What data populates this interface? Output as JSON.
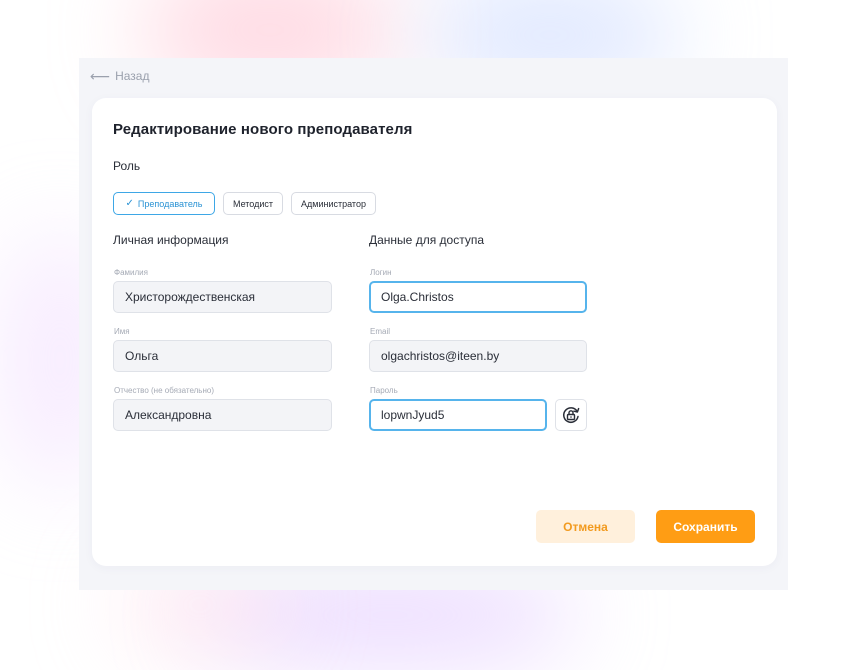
{
  "back_label": "Назад",
  "title": "Редактирование нового преподавателя",
  "role": {
    "label": "Роль",
    "options": [
      "Преподаватель",
      "Методист",
      "Администратор"
    ],
    "selected": "Преподаватель"
  },
  "personal": {
    "heading": "Личная информация",
    "last_name": {
      "label": "Фамилия",
      "value": "Христорождественская"
    },
    "first_name": {
      "label": "Имя",
      "value": "Ольга"
    },
    "patronymic": {
      "label": "Отчество (не обязательно)",
      "value": "Александровна"
    }
  },
  "access": {
    "heading": "Данные для доступа",
    "login": {
      "label": "Логин",
      "value": "Olga.Christos"
    },
    "email": {
      "label": "Email",
      "value": "olgachristos@iteen.by"
    },
    "password": {
      "label": "Пароль",
      "value": "lopwnJyud5"
    }
  },
  "buttons": {
    "cancel": "Отмена",
    "save": "Сохранить"
  },
  "icons": {
    "back": "arrow-left-icon",
    "check": "check-icon",
    "regenerate_password": "lock-refresh-icon"
  },
  "colors": {
    "accent_blue": "#3ea7e6",
    "primary_orange": "#ff9d14",
    "cancel_bg": "#fff0dc"
  }
}
